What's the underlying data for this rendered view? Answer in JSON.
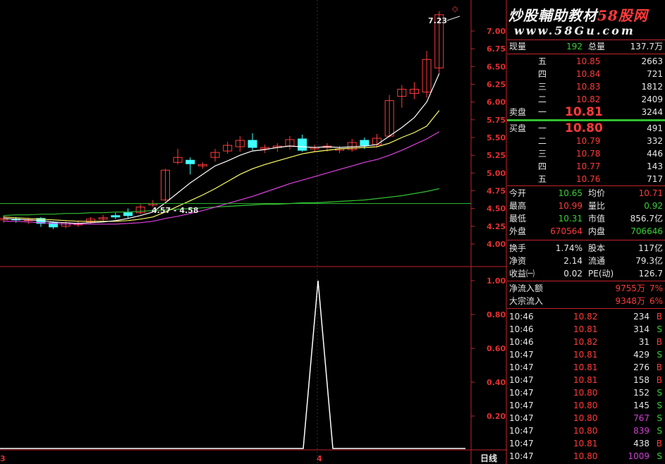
{
  "chart": {
    "left_label": "3",
    "mid_label": "4",
    "period_label": "日线",
    "last_price_marker": "7.23",
    "ma_label": "4.57 - 4.58",
    "price_axis": [
      "7.00",
      "6.75",
      "6.50",
      "6.25",
      "6.00",
      "5.75",
      "5.50",
      "5.25",
      "5.00",
      "4.75",
      "4.50",
      "4.25",
      "4.00"
    ],
    "indicator_axis": [
      "1.00",
      "0.80",
      "0.60",
      "0.40",
      "0.20"
    ]
  },
  "banner": {
    "title_prefix": "炒股輔助教材",
    "title_highlight": "58股网",
    "url": "www.58Gu.com"
  },
  "quote": {
    "vol_now_label": "现量",
    "vol_now": "192",
    "vol_total_label": "总量",
    "vol_total": "137.7万",
    "sell_label": "卖盘",
    "buy_label": "买盘",
    "asks": [
      {
        "level": "五",
        "price": "10.85",
        "qty": "2663"
      },
      {
        "level": "四",
        "price": "10.84",
        "qty": "721"
      },
      {
        "level": "三",
        "price": "10.83",
        "qty": "1812"
      },
      {
        "level": "二",
        "price": "10.82",
        "qty": "2409"
      },
      {
        "level": "一",
        "price": "10.81",
        "qty": "3244"
      }
    ],
    "bids": [
      {
        "level": "一",
        "price": "10.80",
        "qty": "491"
      },
      {
        "level": "二",
        "price": "10.79",
        "qty": "332"
      },
      {
        "level": "三",
        "price": "10.78",
        "qty": "446"
      },
      {
        "level": "四",
        "price": "10.77",
        "qty": "143"
      },
      {
        "level": "五",
        "price": "10.76",
        "qty": "717"
      }
    ],
    "stats": [
      {
        "l1": "今开",
        "v1": "10.65",
        "l2": "均价",
        "v2": "10.71",
        "c1": "c-g",
        "c2": "c-r"
      },
      {
        "l1": "最高",
        "v1": "10.99",
        "l2": "量比",
        "v2": "0.92",
        "c1": "c-r",
        "c2": "c-g"
      },
      {
        "l1": "最低",
        "v1": "10.31",
        "l2": "市值",
        "v2": "856.7亿",
        "c1": "c-g",
        "c2": "c-w"
      },
      {
        "l1": "外盘",
        "v1": "670564",
        "l2": "内盘",
        "v2": "706646",
        "c1": "c-r",
        "c2": "c-g"
      }
    ],
    "stats2": [
      {
        "l1": "换手",
        "v1": "1.74%",
        "l2": "股本",
        "v2": "117亿"
      },
      {
        "l1": "净资",
        "v1": "2.14",
        "l2": "流通",
        "v2": "79.3亿"
      },
      {
        "l1": "收益㈠",
        "v1": "0.02",
        "l2": "PE(动)",
        "v2": "126.7"
      }
    ],
    "flows": [
      {
        "label": "净流入额",
        "value": "9755万",
        "pct": "7%"
      },
      {
        "label": "大宗流入",
        "value": "9348万",
        "pct": "6%"
      }
    ],
    "ticks": [
      {
        "time": "10:46",
        "price": "10.82",
        "vol": "234",
        "side": "B",
        "vc": "c-w",
        "sc": "c-r"
      },
      {
        "time": "10:46",
        "price": "10.81",
        "vol": "314",
        "side": "S",
        "vc": "c-w",
        "sc": "c-g"
      },
      {
        "time": "10:46",
        "price": "10.82",
        "vol": "31",
        "side": "B",
        "vc": "c-w",
        "sc": "c-r"
      },
      {
        "time": "10:47",
        "price": "10.81",
        "vol": "429",
        "side": "S",
        "vc": "c-w",
        "sc": "c-g"
      },
      {
        "time": "10:47",
        "price": "10.81",
        "vol": "276",
        "side": "B",
        "vc": "c-w",
        "sc": "c-r"
      },
      {
        "time": "10:47",
        "price": "10.81",
        "vol": "158",
        "side": "B",
        "vc": "c-w",
        "sc": "c-r"
      },
      {
        "time": "10:47",
        "price": "10.80",
        "vol": "152",
        "side": "S",
        "vc": "c-w",
        "sc": "c-g"
      },
      {
        "time": "10:47",
        "price": "10.80",
        "vol": "145",
        "side": "S",
        "vc": "c-w",
        "sc": "c-g"
      },
      {
        "time": "10:47",
        "price": "10.80",
        "vol": "767",
        "side": "S",
        "vc": "c-m",
        "sc": "c-g"
      },
      {
        "time": "10:47",
        "price": "10.80",
        "vol": "839",
        "side": "S",
        "vc": "c-m",
        "sc": "c-g"
      },
      {
        "time": "10:47",
        "price": "10.81",
        "vol": "438",
        "side": "B",
        "vc": "c-w",
        "sc": "c-r"
      },
      {
        "time": "10:47",
        "price": "10.80",
        "vol": "1009",
        "side": "S",
        "vc": "c-m",
        "sc": "c-g"
      }
    ]
  },
  "colors": {
    "up": "#ff3b3b",
    "down": "#40ffff",
    "ma5": "#ffffff",
    "ma10": "#ffff66",
    "ma20": "#e040e0",
    "ma60": "#30c030",
    "frame": "#c0242a"
  }
}
